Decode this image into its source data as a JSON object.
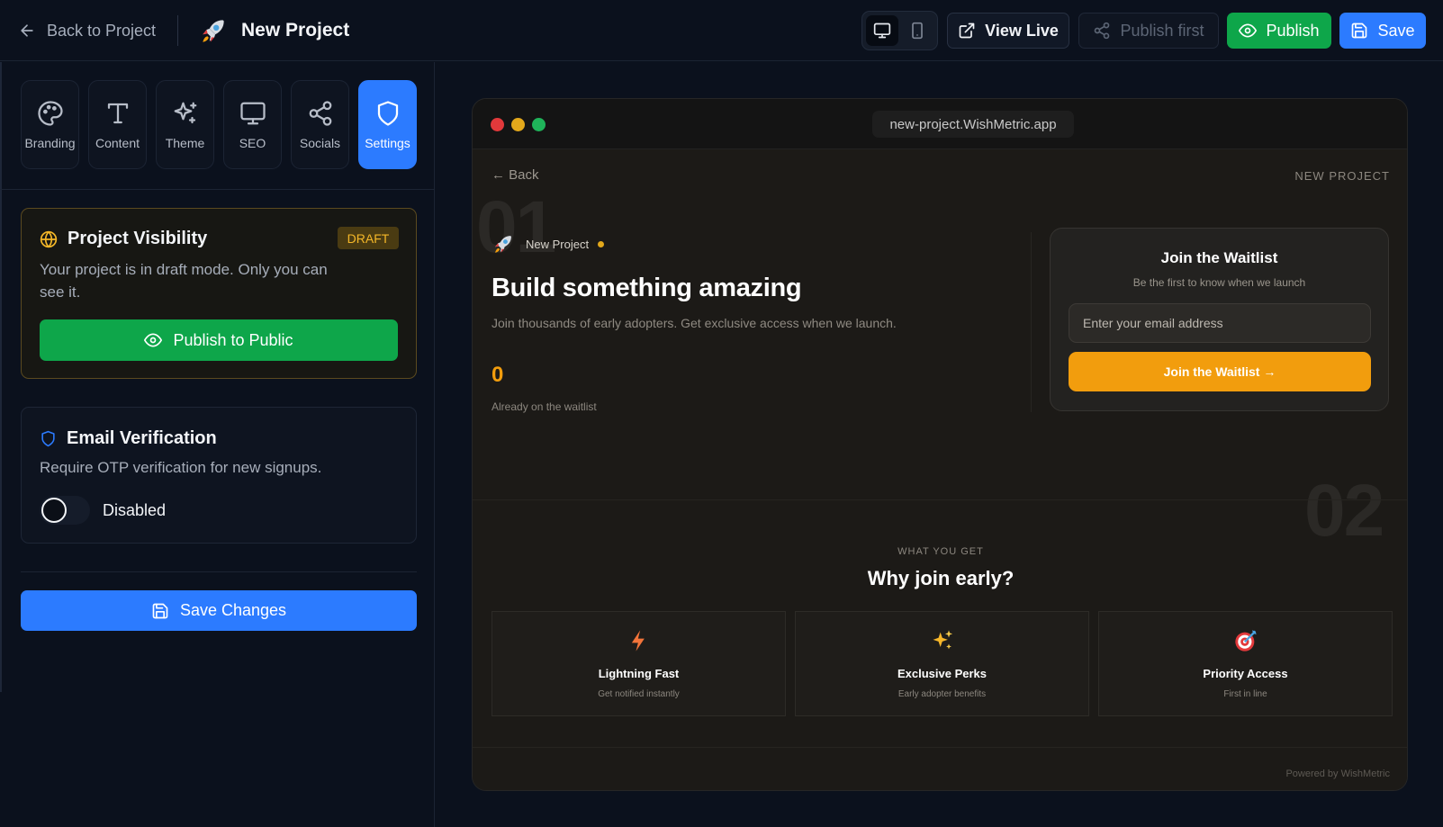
{
  "header": {
    "back_label": "Back to Project",
    "project_name": "New Project",
    "view_live_label": "View Live",
    "publish_first_label": "Publish first",
    "publish_label": "Publish",
    "save_label": "Save",
    "device_modes": [
      "desktop",
      "mobile"
    ],
    "active_device": "desktop"
  },
  "sidebar": {
    "tabs": [
      {
        "label": "Branding",
        "icon": "palette-icon"
      },
      {
        "label": "Content",
        "icon": "type-icon"
      },
      {
        "label": "Theme",
        "icon": "sparkles-icon"
      },
      {
        "label": "SEO",
        "icon": "monitor-icon"
      },
      {
        "label": "Socials",
        "icon": "share-icon"
      },
      {
        "label": "Settings",
        "icon": "shield-icon"
      }
    ],
    "active_tab": "Settings",
    "visibility": {
      "title": "Project Visibility",
      "badge": "DRAFT",
      "description": "Your project is in draft mode. Only you can see it.",
      "button_label": "Publish to Public"
    },
    "email_verification": {
      "title": "Email Verification",
      "description": "Require OTP verification for new signups.",
      "toggle_label": "Disabled",
      "enabled": false
    },
    "save_changes_label": "Save Changes"
  },
  "preview": {
    "url": "new-project.WishMetric.app",
    "back_label": "← Back",
    "project_label": "NEW PROJECT",
    "section_numbers": [
      "01",
      "02"
    ],
    "hero": {
      "brand_name": "New Project",
      "title": "Build something amazing",
      "subtitle": "Join thousands of early adopters. Get exclusive access when we launch.",
      "count": "0",
      "count_label": "Already on the waitlist"
    },
    "waitlist": {
      "title": "Join the Waitlist",
      "subtitle": "Be the first to know when we launch",
      "email_placeholder": "Enter your email address",
      "button_label": "Join the Waitlist →"
    },
    "features_section": {
      "eyebrow": "WHAT YOU GET",
      "title": "Why join early?",
      "items": [
        {
          "name": "Lightning Fast",
          "description": "Get notified instantly",
          "icon": "lightning-icon"
        },
        {
          "name": "Exclusive Perks",
          "description": "Early adopter benefits",
          "icon": "sparkles-icon"
        },
        {
          "name": "Priority Access",
          "description": "First in line",
          "icon": "target-icon"
        }
      ]
    },
    "footer": "Powered by WishMetric"
  },
  "colors": {
    "accent_blue": "#2c7bff",
    "accent_green": "#0ea64a",
    "accent_orange": "#f29d0d",
    "draft_badge": "#f4b728"
  }
}
